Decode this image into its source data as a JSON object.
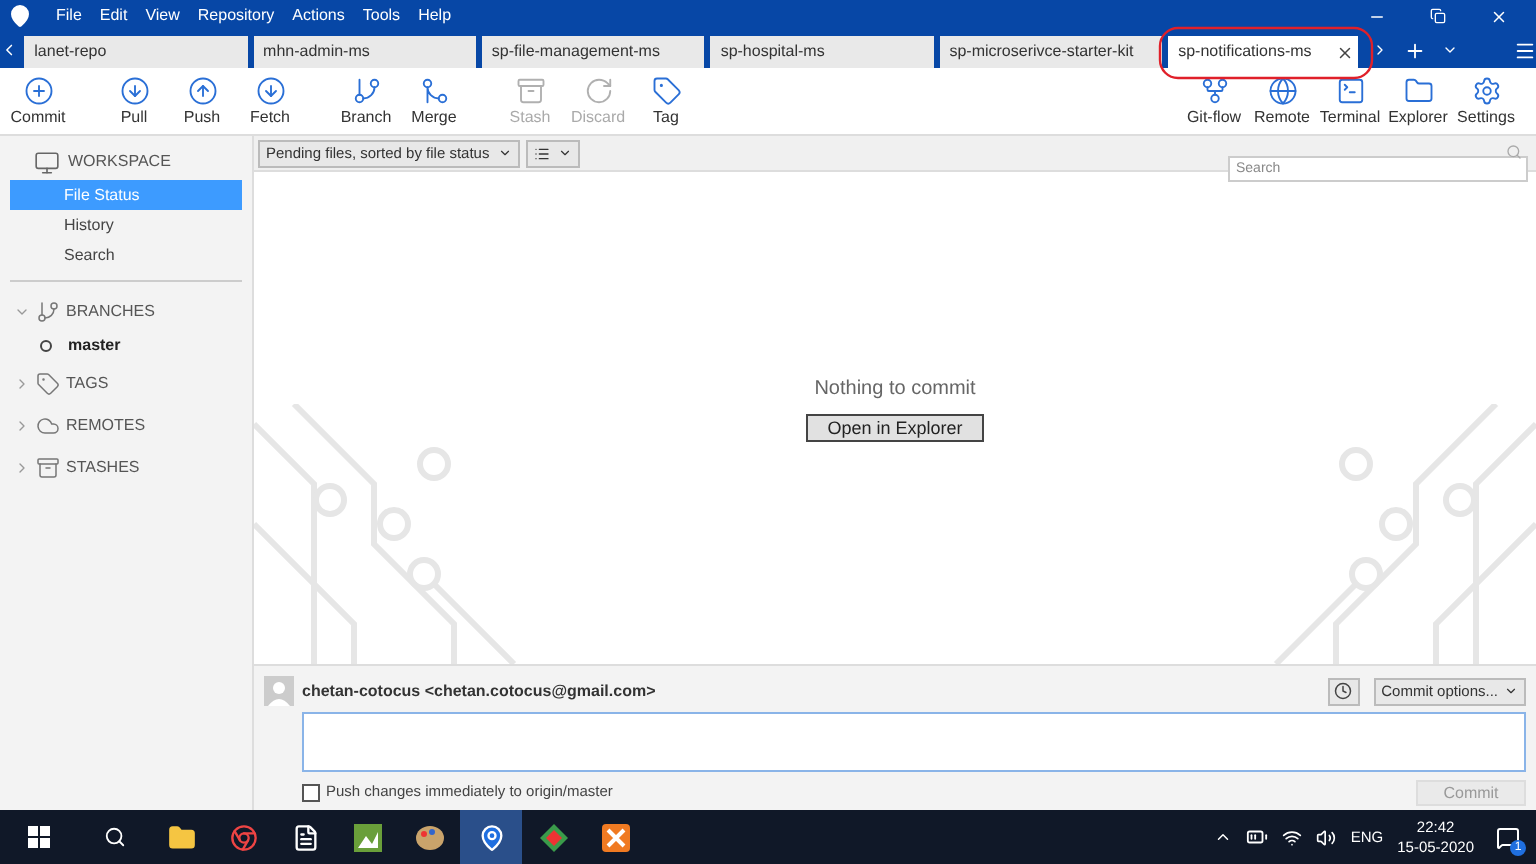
{
  "menu": [
    "File",
    "Edit",
    "View",
    "Repository",
    "Actions",
    "Tools",
    "Help"
  ],
  "tabs": [
    {
      "label": "lanet-repo",
      "selected": false
    },
    {
      "label": "mhn-admin-ms",
      "selected": false
    },
    {
      "label": "sp-file-management-ms",
      "selected": false
    },
    {
      "label": "sp-hospital-ms",
      "selected": false
    },
    {
      "label": "sp-microserivce-starter-kit",
      "selected": false
    },
    {
      "label": "sp-notifications-ms",
      "selected": true
    }
  ],
  "toolbar_left": [
    {
      "label": "Commit",
      "kind": "commit",
      "disabled": false
    },
    {
      "label": "Pull",
      "kind": "pull",
      "disabled": false
    },
    {
      "label": "Push",
      "kind": "push",
      "disabled": false
    },
    {
      "label": "Fetch",
      "kind": "fetch",
      "disabled": false
    },
    {
      "label": "Branch",
      "kind": "branch",
      "disabled": false
    },
    {
      "label": "Merge",
      "kind": "merge",
      "disabled": false
    },
    {
      "label": "Stash",
      "kind": "stash",
      "disabled": true
    },
    {
      "label": "Discard",
      "kind": "discard",
      "disabled": true
    },
    {
      "label": "Tag",
      "kind": "tag",
      "disabled": false
    }
  ],
  "toolbar_right": [
    {
      "label": "Git-flow",
      "kind": "gitflow",
      "disabled": false
    },
    {
      "label": "Remote",
      "kind": "remote",
      "disabled": false
    },
    {
      "label": "Terminal",
      "kind": "terminal",
      "disabled": false
    },
    {
      "label": "Explorer",
      "kind": "explorer",
      "disabled": false
    },
    {
      "label": "Settings",
      "kind": "settings",
      "disabled": false
    }
  ],
  "file_filter": "Pending files, sorted by file status",
  "search": {
    "placeholder": "Search"
  },
  "sidebar": {
    "workspace": {
      "label": "WORKSPACE",
      "items": [
        {
          "label": "File Status",
          "selected": true
        },
        {
          "label": "History",
          "selected": false
        },
        {
          "label": "Search",
          "selected": false
        }
      ]
    },
    "sections": [
      {
        "label": "BRANCHES",
        "kind": "branch",
        "expanded": true,
        "children": [
          {
            "label": "master"
          }
        ]
      },
      {
        "label": "TAGS",
        "kind": "tag",
        "expanded": false
      },
      {
        "label": "REMOTES",
        "kind": "remote",
        "expanded": false
      },
      {
        "label": "STASHES",
        "kind": "stash",
        "expanded": false
      }
    ]
  },
  "empty_state": {
    "message": "Nothing to commit",
    "button": "Open in Explorer"
  },
  "commit": {
    "author": "chetan-cotocus <chetan.cotocus@gmail.com>",
    "options": "Commit options...",
    "push_checkbox": {
      "label": "Push changes immediately to origin/master",
      "checked": false
    },
    "button": "Commit",
    "button_disabled": true
  },
  "taskbar": {
    "language": "ENG",
    "time": "22:42",
    "date": "15-05-2020",
    "notifications": "1"
  }
}
